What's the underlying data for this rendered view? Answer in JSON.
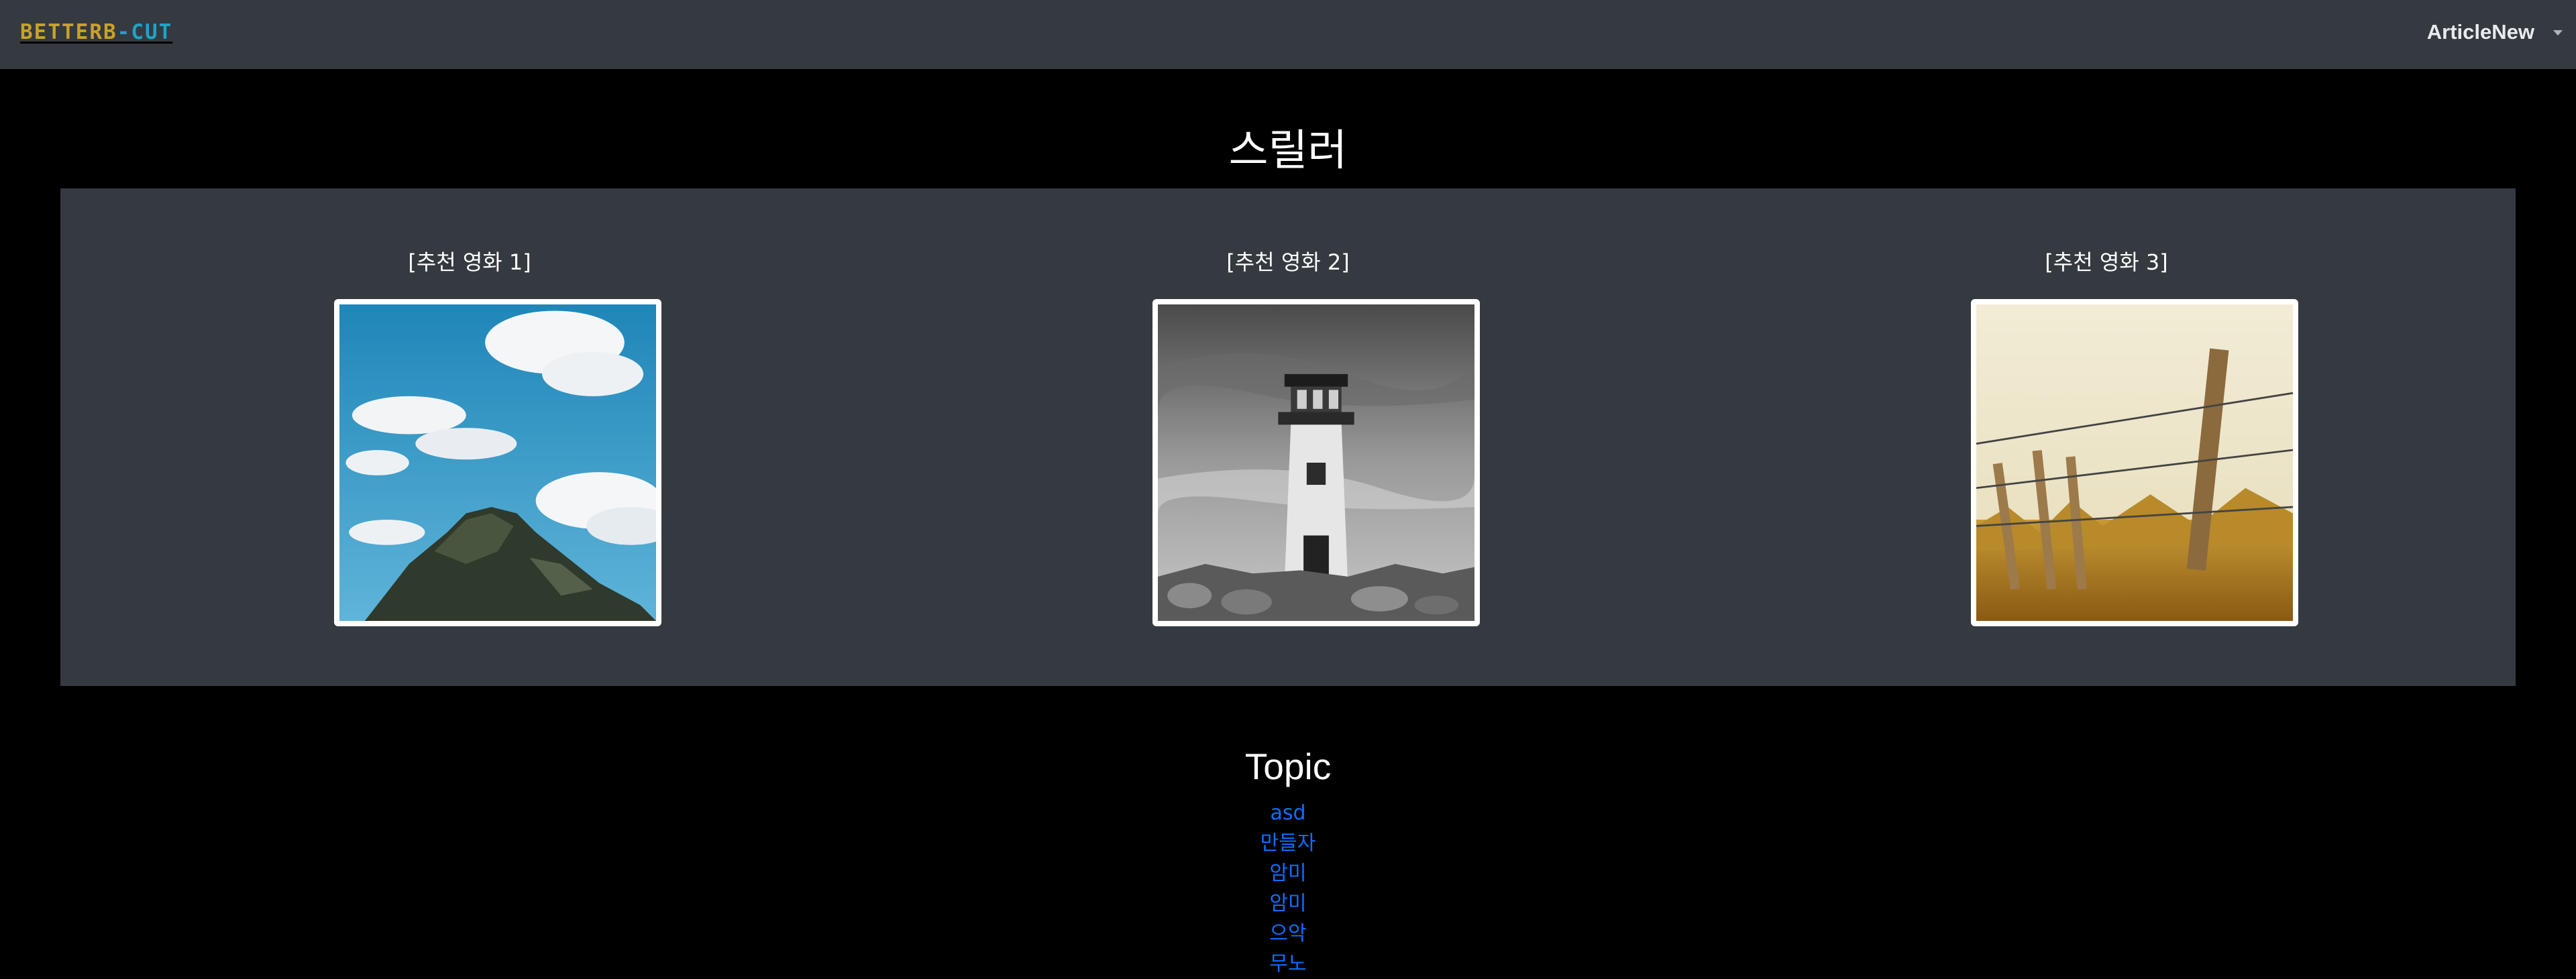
{
  "navbar": {
    "brand_part1": "BETTERB",
    "brand_part2": "-CUT",
    "user_name": "ArticleNew"
  },
  "genre": {
    "title": "스릴러"
  },
  "recommendations": [
    {
      "label": "[추천 영화 1]",
      "image": "sky-cliff-photo"
    },
    {
      "label": "[추천 영화 2]",
      "image": "lighthouse-photo"
    },
    {
      "label": "[추천 영화 3]",
      "image": "fence-field-photo"
    }
  ],
  "topics": {
    "title": "Topic",
    "items": [
      {
        "label": "asd"
      },
      {
        "label": "만들자"
      },
      {
        "label": "암미"
      },
      {
        "label": "암미"
      },
      {
        "label": "으악"
      },
      {
        "label": "무노"
      }
    ]
  },
  "colors": {
    "navbar_bg": "#343a40",
    "page_bg": "#000000",
    "panel_bg": "#343a40",
    "brand_gold": "#c9a227",
    "brand_cyan": "#1fa3c7",
    "link_blue": "#0d6efd"
  }
}
